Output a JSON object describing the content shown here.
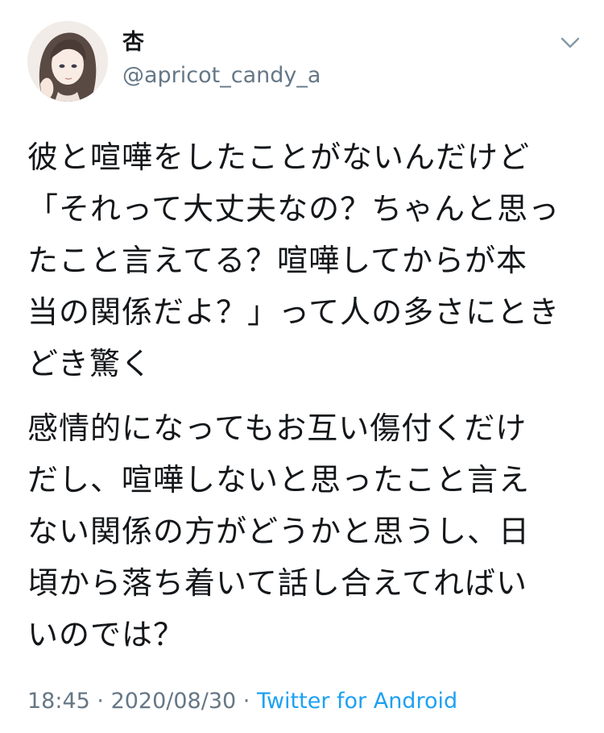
{
  "user": {
    "display_name": "杏",
    "handle": "@apricot_candy_a",
    "avatar_icon": "illustrated-avatar"
  },
  "menu_icon": "chevron-down-icon",
  "tweet": {
    "paragraphs": [
      [
        "彼と喧嘩をしたことがないんだけど",
        "「それって大丈夫なの？ちゃんと思っ",
        "たこと言えてる？喧嘩してからが本",
        "当の関係だよ？」って人の多さにとき",
        "どき驚く"
      ],
      [
        "感情的になってもお互い傷付くだけ",
        "だし、喧嘩しないと思ったこと言え",
        "ない関係の方がどうかと思うし、日",
        "頃から落ち着いて話し合えてればい",
        "いのでは？"
      ]
    ]
  },
  "meta": {
    "time": "18:45",
    "separator": " · ",
    "date": "2020/08/30",
    "source": "Twitter for Android"
  },
  "colors": {
    "text": "#14171a",
    "secondary": "#657786",
    "link": "#1da1f2"
  }
}
